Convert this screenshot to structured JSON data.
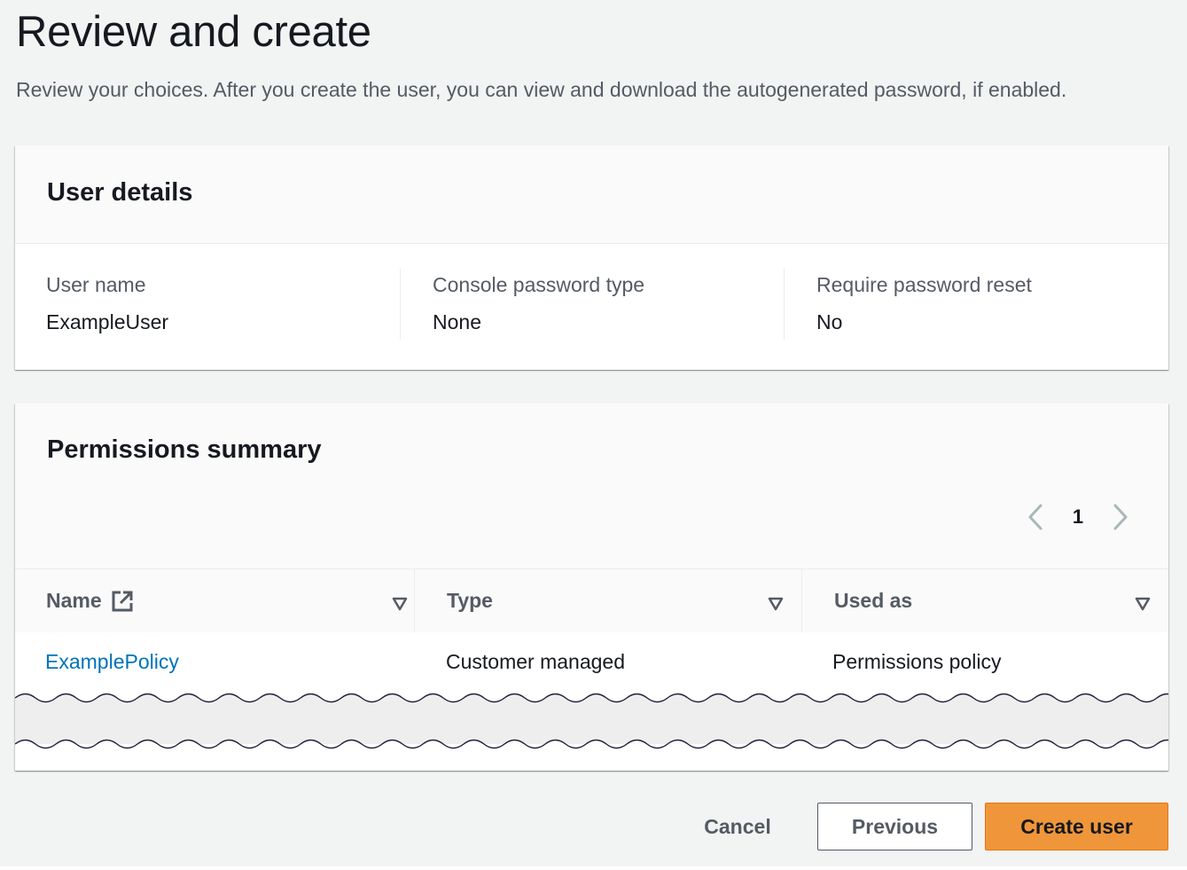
{
  "page": {
    "title": "Review and create",
    "description": "Review your choices. After you create the user, you can view and download the autogenerated password, if enabled."
  },
  "user_details": {
    "title": "User details",
    "fields": [
      {
        "label": "User name",
        "value": "ExampleUser"
      },
      {
        "label": "Console password type",
        "value": "None"
      },
      {
        "label": "Require password reset",
        "value": "No"
      }
    ]
  },
  "permissions_summary": {
    "title": "Permissions summary",
    "pagination": {
      "current_page": "1"
    },
    "columns": [
      "Name",
      "Type",
      "Used as"
    ],
    "rows": [
      {
        "name": "ExamplePolicy",
        "type": "Customer managed",
        "used_as": "Permissions policy"
      }
    ]
  },
  "actions": {
    "cancel": "Cancel",
    "previous": "Previous",
    "create": "Create user"
  },
  "colors": {
    "link": "#0073bb",
    "primary_button": "#f0963a",
    "background": "#f2f3f3"
  },
  "icons": {
    "pagination_prev": "chevron-left-icon",
    "pagination_next": "chevron-right-icon",
    "external_link": "external-link-icon",
    "sort": "caret-down-outline-icon"
  }
}
